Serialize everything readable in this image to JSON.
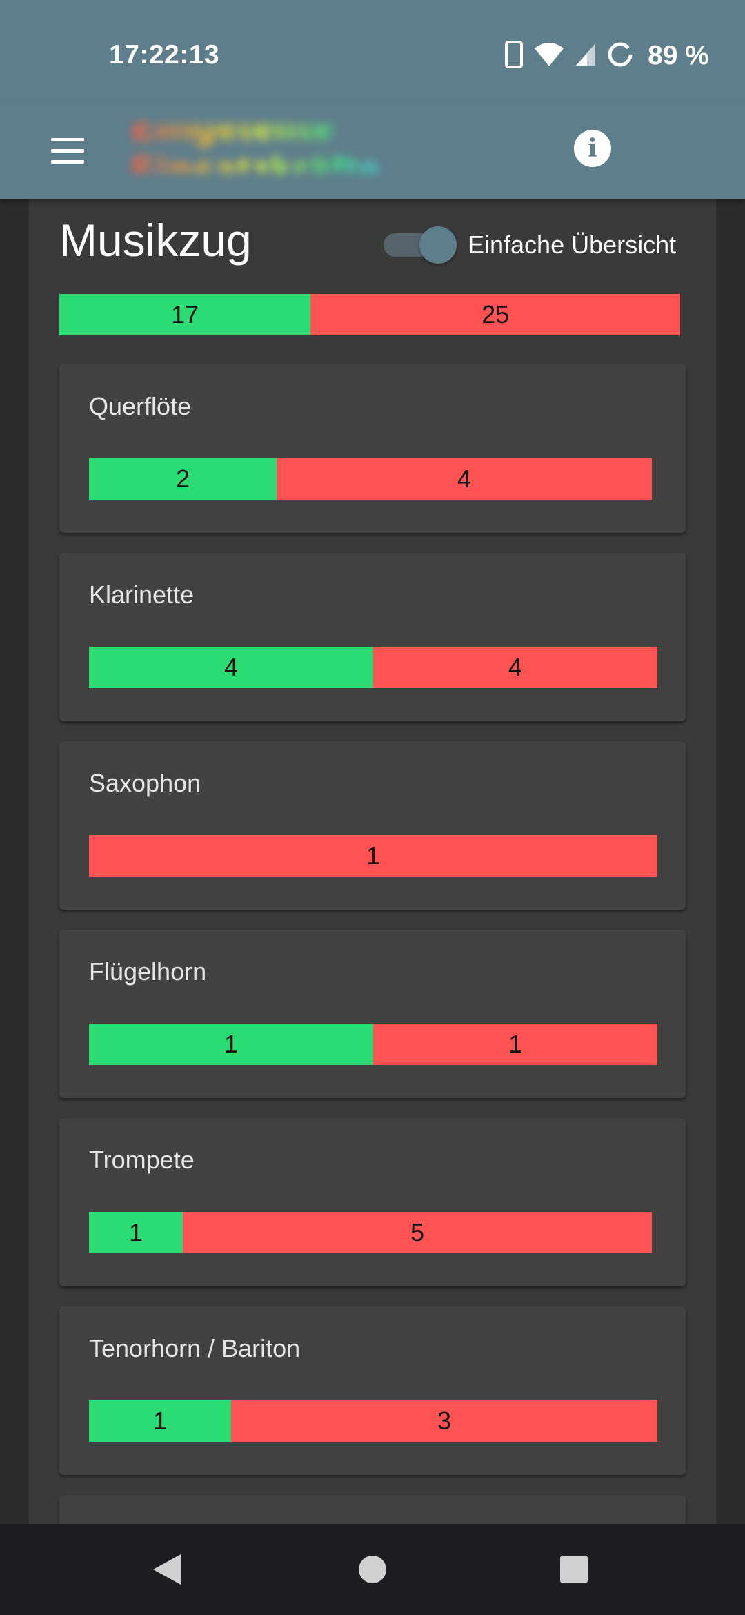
{
  "status": {
    "time": "17:22:13",
    "battery": "89 %"
  },
  "appbar": {
    "title": "Eingeteilte Einsatzkräfte"
  },
  "section": {
    "title": "Musikzug",
    "toggle_label": "Einfache Übersicht",
    "toggle_on": true,
    "total": {
      "present": 17,
      "absent": 25
    }
  },
  "instruments": [
    {
      "name": "Querflöte",
      "present": 2,
      "absent": 4
    },
    {
      "name": "Klarinette",
      "present": 4,
      "absent": 4
    },
    {
      "name": "Saxophon",
      "present": 0,
      "absent": 1
    },
    {
      "name": "Flügelhorn",
      "present": 1,
      "absent": 1
    },
    {
      "name": "Trompete",
      "present": 1,
      "absent": 5
    },
    {
      "name": "Tenorhorn / Bariton",
      "present": 1,
      "absent": 3
    }
  ],
  "colors": {
    "present": "#2bdc74",
    "absent": "#ff5252",
    "bar_primary": "#5f7e8c"
  }
}
